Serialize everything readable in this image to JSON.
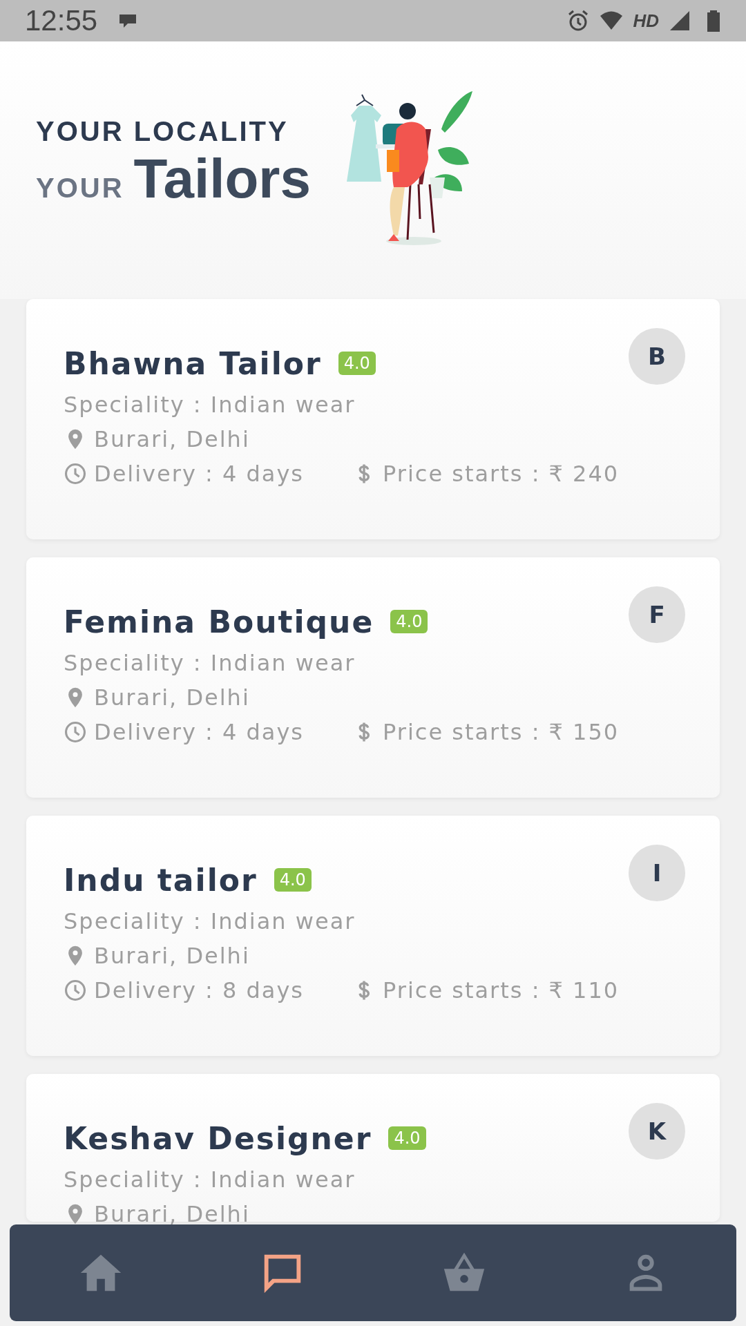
{
  "status_bar": {
    "time": "12:55",
    "network": "HD"
  },
  "header": {
    "line_1": "YOUR LOCALITY",
    "line_2_prefix": "YOUR",
    "line_2_main": "Tailors"
  },
  "tailors": [
    {
      "name": "Bhawna Tailor",
      "rating": "4.0",
      "initial": "B",
      "speciality": "Speciality : Indian wear",
      "location": "Burari, Delhi",
      "delivery": "Delivery : 4 days",
      "price": "Price starts : ₹ 240"
    },
    {
      "name": "Femina Boutique",
      "rating": "4.0",
      "initial": "F",
      "speciality": "Speciality : Indian wear",
      "location": "Burari, Delhi",
      "delivery": "Delivery : 4 days",
      "price": "Price starts : ₹ 150"
    },
    {
      "name": "Indu tailor",
      "rating": "4.0",
      "initial": "I",
      "speciality": "Speciality : Indian wear",
      "location": "Burari, Delhi",
      "delivery": "Delivery : 8 days",
      "price": "Price starts : ₹ 110"
    },
    {
      "name": "Keshav Designer",
      "rating": "4.0",
      "initial": "K",
      "speciality": "Speciality : Indian wear",
      "location": "Burari, Delhi"
    }
  ],
  "bottom_nav": [
    {
      "kind": "home",
      "selected": false
    },
    {
      "kind": "chat",
      "selected": true
    },
    {
      "kind": "basket",
      "selected": false
    },
    {
      "kind": "profile",
      "selected": false
    }
  ]
}
